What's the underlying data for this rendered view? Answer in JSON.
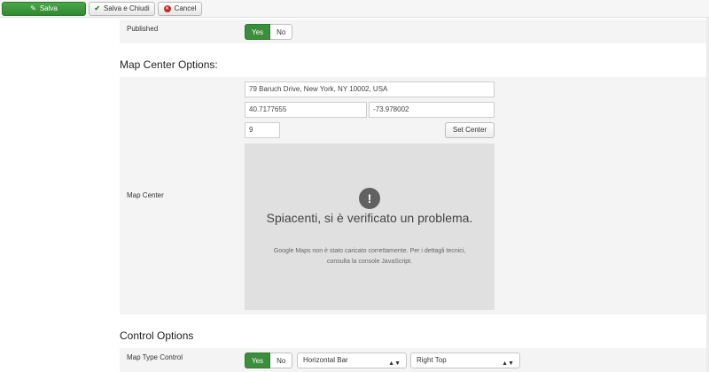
{
  "toolbar": {
    "save_label": "Salva",
    "save_close_label": "Salva e Chiudi",
    "cancel_label": "Cancel"
  },
  "published": {
    "label": "Published",
    "yes": "Yes",
    "no": "No",
    "selected": "Yes"
  },
  "map_center_options": {
    "title": "Map Center Options:",
    "label": "Map Center",
    "address": "79 Baruch Drive, New York, NY 10002, USA",
    "latitude": "40.7177655",
    "longitude": "-73.978002",
    "zoom": "9",
    "set_center_label": "Set Center",
    "map_error": {
      "icon": "!",
      "title": "Spiacenti, si è verificato un problema.",
      "body": "Google Maps non è stato caricato correttamente. Per i dettagli tecnici, consulta la console JavaScript."
    }
  },
  "control_options": {
    "title": "Control Options",
    "map_type_control": {
      "label": "Map Type Control",
      "yes": "Yes",
      "no": "No",
      "selected": "Yes",
      "style_value": "Horizontal Bar",
      "position_value": "Right Top"
    }
  },
  "colors": {
    "success": "#3b8e3b",
    "danger": "#c62828"
  }
}
